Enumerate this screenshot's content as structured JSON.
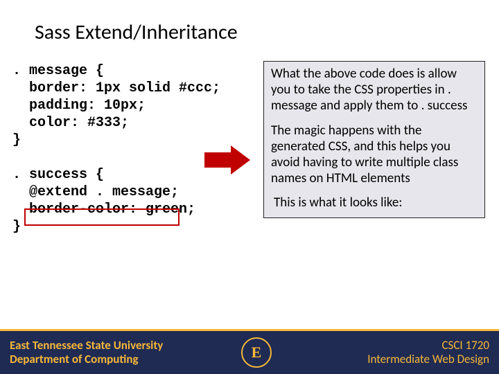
{
  "title": "Sass Extend/Inheritance",
  "code": {
    "line1": ". message {",
    "line2": "  border: 1px solid #ccc;",
    "line3": "  padding: 10px;",
    "line4": "  color: #333;",
    "line5": "}",
    "blank": "",
    "line6": ". success {",
    "line7": "  @extend . message;",
    "line8": "  border-color: green;",
    "line9": "}"
  },
  "explain": {
    "p1": "What the above code does is allow you to take the CSS properties in . message and apply them to . success",
    "p2": "The magic happens with the generated CSS, and this helps you avoid having to write multiple class names on HTML elements",
    "p3": "This is what it looks like:"
  },
  "footer": {
    "uni_line1": "East Tennessee State University",
    "uni_line2": "Department of Computing",
    "course_code": "CSCI 1720",
    "course_name": "Intermediate Web Design",
    "logo_letter": "E"
  }
}
